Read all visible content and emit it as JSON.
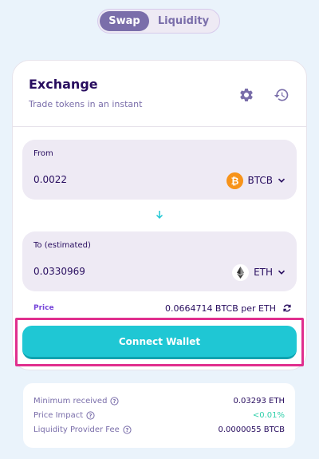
{
  "tabs": [
    {
      "label": "Swap",
      "active": true
    },
    {
      "label": "Liquidity",
      "active": false
    }
  ],
  "card": {
    "title": "Exchange",
    "subtitle": "Trade tokens in an instant",
    "settings_icon": "gear-icon",
    "history_icon": "history-icon"
  },
  "from": {
    "label": "From",
    "amount": "0.0022",
    "token": "BTCB",
    "token_icon": "btcb-icon",
    "token_color": "#f7931a"
  },
  "to": {
    "label": "To (estimated)",
    "amount": "0.0330969",
    "token": "ETH",
    "token_icon": "eth-icon"
  },
  "price": {
    "label": "Price",
    "value": "0.0664714 BTCB per ETH"
  },
  "connect_button": "Connect Wallet",
  "details": [
    {
      "label": "Minimum received",
      "value": "0.03293 ETH",
      "value_color": "#280d5f"
    },
    {
      "label": "Price Impact",
      "value": "<0.01%",
      "value_color": "#31d0aa"
    },
    {
      "label": "Liquidity Provider Fee",
      "value": "0.0000055 BTCB",
      "value_color": "#280d5f"
    }
  ],
  "colors": {
    "background": "#eaf3fb",
    "accent": "#1fc7d4",
    "primary_text": "#280d5f",
    "secondary_text": "#7a6eaa",
    "highlight": "#e02f8e"
  }
}
